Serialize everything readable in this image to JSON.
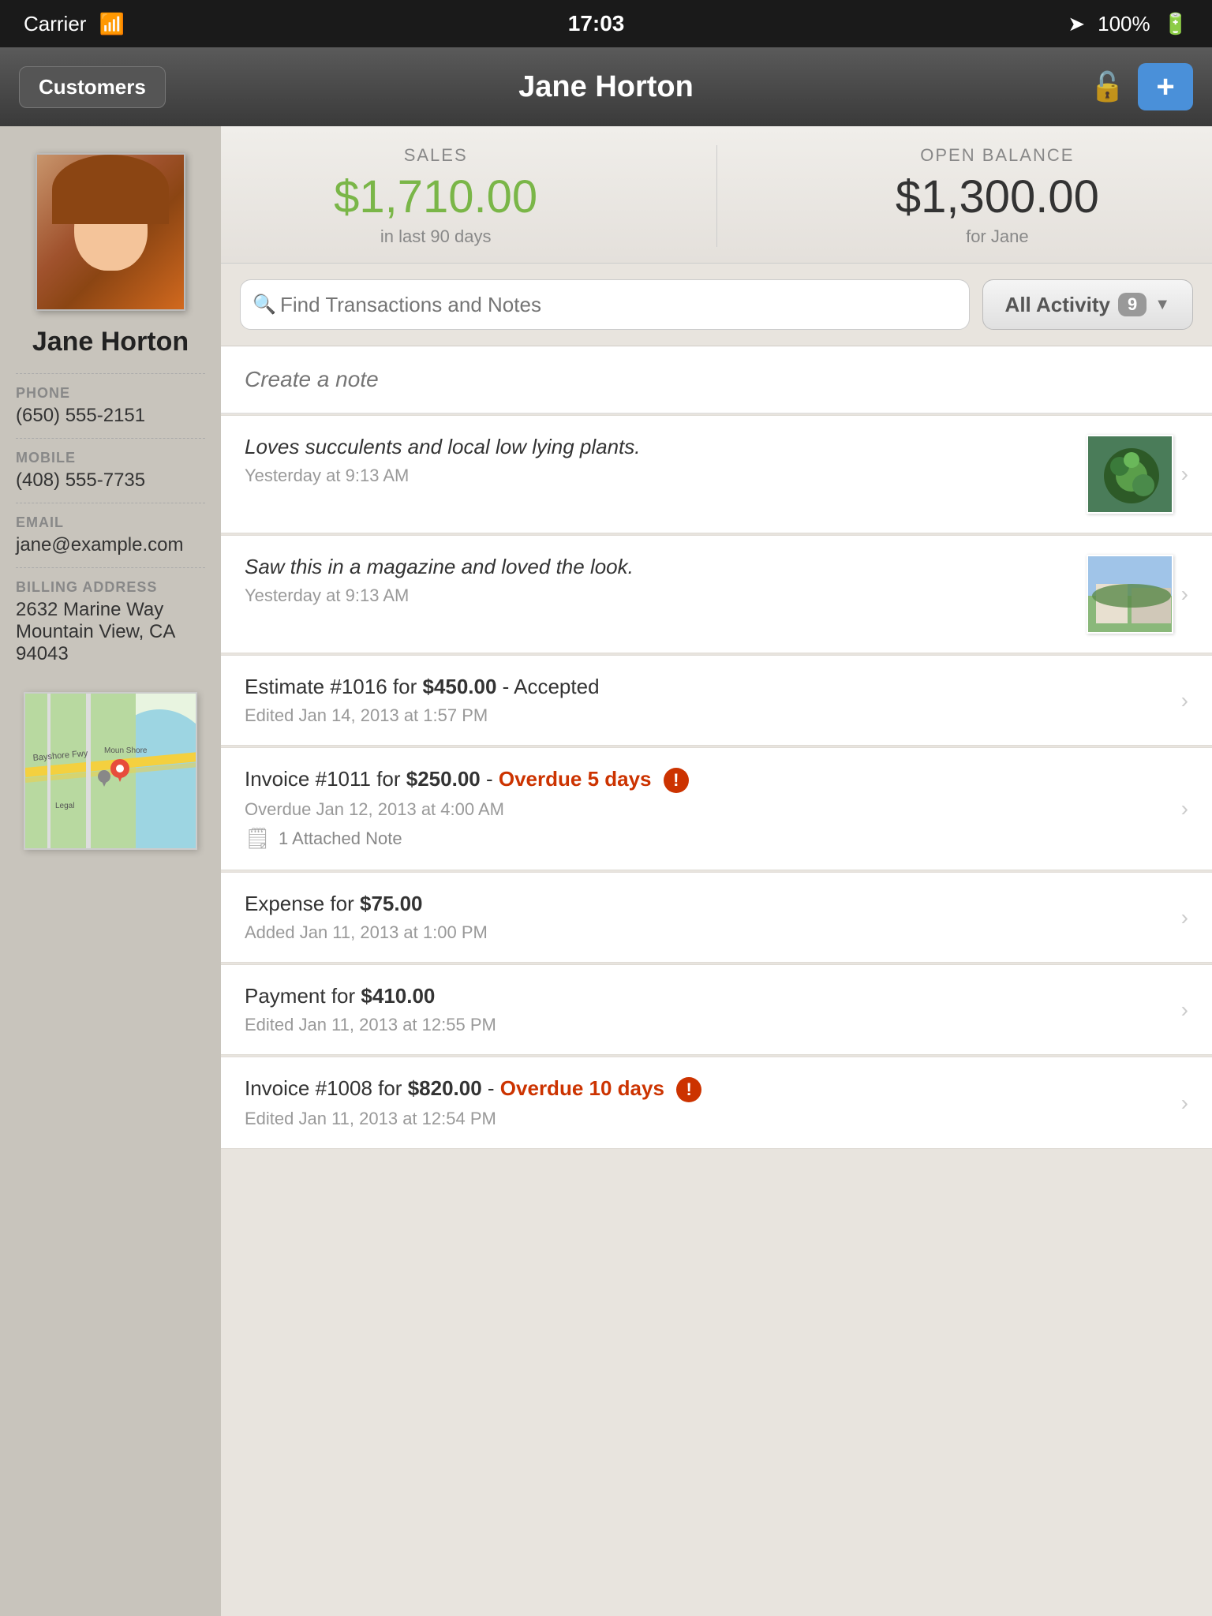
{
  "statusBar": {
    "carrier": "Carrier",
    "time": "17:03",
    "battery": "100%"
  },
  "navBar": {
    "backLabel": "Customers",
    "title": "Jane Horton",
    "addIcon": "+"
  },
  "stats": {
    "salesLabel": "SALES",
    "salesValue": "$1,710.00",
    "salesSub": "in last 90 days",
    "balanceLabel": "OPEN BALANCE",
    "balanceValue": "$1,300.00",
    "balanceSub": "for Jane"
  },
  "search": {
    "placeholder": "Find Transactions and Notes",
    "filterLabel": "All Activity",
    "filterCount": "9"
  },
  "createNote": {
    "placeholder": "Create a note"
  },
  "customer": {
    "name": "Jane Horton",
    "phone": "(650) 555-2151",
    "mobile": "(408) 555-7735",
    "email": "jane@example.com",
    "billingAddress": "2632 Marine Way\nMountain View, CA 94043",
    "phoneLabel": "PHONE",
    "mobileLabel": "MOBILE",
    "emailLabel": "EMAIL",
    "addressLabel": "BILLING ADDRESS"
  },
  "activities": [
    {
      "id": 1,
      "type": "note",
      "title": "Loves succulents and local low lying plants.",
      "subtitle": "Yesterday at 9:13 AM",
      "italic": true,
      "hasThumb": true,
      "thumbType": "succulent"
    },
    {
      "id": 2,
      "type": "note",
      "title": "Saw this in a magazine and loved the look.",
      "subtitle": "Yesterday at 9:13 AM",
      "italic": true,
      "hasThumb": true,
      "thumbType": "garden"
    },
    {
      "id": 3,
      "type": "estimate",
      "title": "Estimate #1016 for ",
      "titleBold": "$450.00",
      "titleSuffix": " - Accepted",
      "subtitle": "Edited Jan 14, 2013 at 1:57 PM",
      "italic": false,
      "hasThumb": false
    },
    {
      "id": 4,
      "type": "invoice",
      "title": "Invoice #1011 for ",
      "titleBold": "$250.00",
      "titleSuffix": " - Overdue 5 days",
      "subtitle": "Overdue Jan 12, 2013 at 4:00 AM",
      "italic": false,
      "hasThumb": false,
      "overdue": true,
      "attachedNote": "1 Attached Note"
    },
    {
      "id": 5,
      "type": "expense",
      "title": "Expense for ",
      "titleBold": "$75.00",
      "titleSuffix": "",
      "subtitle": "Added Jan 11, 2013 at 1:00 PM",
      "italic": false,
      "hasThumb": false
    },
    {
      "id": 6,
      "type": "payment",
      "title": "Payment for ",
      "titleBold": "$410.00",
      "titleSuffix": "",
      "subtitle": "Edited Jan 11, 2013 at 12:55 PM",
      "italic": false,
      "hasThumb": false
    },
    {
      "id": 7,
      "type": "invoice",
      "title": "Invoice #1008 for ",
      "titleBold": "$820.00",
      "titleSuffix": " - Overdue 10 days",
      "subtitle": "Edited Jan 11, 2013 at 12:54 PM",
      "italic": false,
      "hasThumb": false,
      "overdue": true
    }
  ]
}
